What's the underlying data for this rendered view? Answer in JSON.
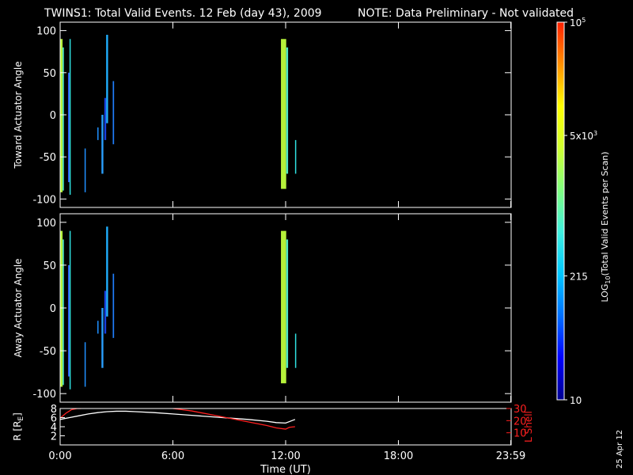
{
  "header": {
    "title": "TWINS1: Total Valid Events. 12 Feb (day  43), 2009",
    "note": "NOTE: Data Preliminary - Not validated",
    "note_color": "#ff2020"
  },
  "footer": {
    "date_stamp": "25 Apr 12"
  },
  "chart_data": [
    {
      "type": "heatmap",
      "name": "toward",
      "ylabel": "Toward Actuator Angle",
      "ylim": [
        -110,
        110
      ],
      "xlim": [
        0,
        24
      ],
      "yticks": [
        -100,
        -50,
        0,
        50,
        100
      ],
      "bars": [
        {
          "x0": 0.0,
          "x1": 0.13,
          "y0": -92,
          "y1": 90,
          "color": "#b6f23a"
        },
        {
          "x0": 0.13,
          "x1": 0.2,
          "y0": -90,
          "y1": 80,
          "color": "#50e8c8"
        },
        {
          "x0": 0.42,
          "x1": 0.5,
          "y0": -80,
          "y1": 50,
          "color": "#3060ff"
        },
        {
          "x0": 0.5,
          "x1": 0.55,
          "y0": -95,
          "y1": 90,
          "color": "#30e0e0"
        },
        {
          "x0": 1.3,
          "x1": 1.36,
          "y0": -92,
          "y1": -40,
          "color": "#2090ff"
        },
        {
          "x0": 1.98,
          "x1": 2.04,
          "y0": -30,
          "y1": -15,
          "color": "#2090ff"
        },
        {
          "x0": 2.2,
          "x1": 2.3,
          "y0": -70,
          "y1": 0,
          "color": "#2aa0ff"
        },
        {
          "x0": 2.35,
          "x1": 2.45,
          "y0": -30,
          "y1": 20,
          "color": "#1840e0"
        },
        {
          "x0": 2.45,
          "x1": 2.55,
          "y0": -10,
          "y1": 95,
          "color": "#20b0ff"
        },
        {
          "x0": 2.8,
          "x1": 2.87,
          "y0": -35,
          "y1": 40,
          "color": "#2080ff"
        },
        {
          "x0": 11.75,
          "x1": 12.03,
          "y0": -88,
          "y1": 90,
          "color": "#b6f23a"
        },
        {
          "x0": 12.03,
          "x1": 12.13,
          "y0": -70,
          "y1": 80,
          "color": "#50e8c8"
        },
        {
          "x0": 12.5,
          "x1": 12.56,
          "y0": -70,
          "y1": -30,
          "color": "#30e0e0"
        }
      ]
    },
    {
      "type": "heatmap",
      "name": "away",
      "ylabel": "Away Actuator Angle",
      "ylim": [
        -110,
        110
      ],
      "xlim": [
        0,
        24
      ],
      "yticks": [
        -100,
        -50,
        0,
        50,
        100
      ],
      "bars": [
        {
          "x0": 0.0,
          "x1": 0.13,
          "y0": -92,
          "y1": 90,
          "color": "#b6f23a"
        },
        {
          "x0": 0.13,
          "x1": 0.2,
          "y0": -90,
          "y1": 80,
          "color": "#50e8c8"
        },
        {
          "x0": 0.42,
          "x1": 0.5,
          "y0": -80,
          "y1": 50,
          "color": "#3060ff"
        },
        {
          "x0": 0.5,
          "x1": 0.55,
          "y0": -95,
          "y1": 90,
          "color": "#30e0e0"
        },
        {
          "x0": 1.3,
          "x1": 1.36,
          "y0": -92,
          "y1": -40,
          "color": "#2090ff"
        },
        {
          "x0": 1.98,
          "x1": 2.04,
          "y0": -30,
          "y1": -15,
          "color": "#2090ff"
        },
        {
          "x0": 2.2,
          "x1": 2.3,
          "y0": -70,
          "y1": 0,
          "color": "#2aa0ff"
        },
        {
          "x0": 2.35,
          "x1": 2.45,
          "y0": -30,
          "y1": 20,
          "color": "#1840e0"
        },
        {
          "x0": 2.45,
          "x1": 2.55,
          "y0": -10,
          "y1": 95,
          "color": "#20b0ff"
        },
        {
          "x0": 2.8,
          "x1": 2.87,
          "y0": -35,
          "y1": 40,
          "color": "#2080ff"
        },
        {
          "x0": 11.75,
          "x1": 12.03,
          "y0": -88,
          "y1": 90,
          "color": "#b6f23a"
        },
        {
          "x0": 12.03,
          "x1": 12.13,
          "y0": -70,
          "y1": 80,
          "color": "#50e8c8"
        },
        {
          "x0": 12.5,
          "x1": 12.56,
          "y0": -70,
          "y1": -30,
          "color": "#30e0e0"
        }
      ]
    },
    {
      "type": "line",
      "name": "ephemeris",
      "ylabel": "R [R",
      "ylabel_sub": "E",
      "ylabel_close": "]",
      "ylim": [
        0,
        8
      ],
      "yticks": [
        2,
        4,
        6,
        8
      ],
      "ylabel_right": "L Shell",
      "ylim_right": [
        0,
        30
      ],
      "yticks_right": [
        10,
        20,
        30
      ],
      "right_color": "#ff2020",
      "xlim": [
        0,
        24
      ],
      "xticks": [
        0,
        6,
        12,
        18,
        23.98
      ],
      "xticklabels": [
        "0:00",
        "6:00",
        "12:00",
        "18:00",
        "23:59"
      ],
      "xlabel": "Time (UT)",
      "series": [
        {
          "axis": "left",
          "color": "#ffffff",
          "x": [
            0,
            0.5,
            1,
            1.5,
            2,
            2.5,
            3,
            3.5,
            4,
            5,
            6,
            7,
            8,
            9,
            10,
            11,
            11.5,
            12,
            12.5
          ],
          "y": [
            5.6,
            6.0,
            6.4,
            6.8,
            7.1,
            7.3,
            7.4,
            7.4,
            7.3,
            7.1,
            6.8,
            6.5,
            6.2,
            5.9,
            5.6,
            5.2,
            4.9,
            4.8,
            5.6
          ]
        },
        {
          "axis": "right",
          "color": "#ff2020",
          "x": [
            0,
            0.3,
            0.6,
            0.9,
            1.1
          ],
          "y": [
            22,
            26,
            29,
            30,
            30
          ]
        },
        {
          "axis": "right",
          "color": "#ff2020",
          "x": [
            6.0,
            6.5,
            7,
            8,
            9,
            10,
            11,
            11.5,
            12,
            12.2,
            12.5
          ],
          "y": [
            30,
            29,
            28,
            25,
            22,
            19,
            16,
            14,
            13,
            14.5,
            15
          ]
        }
      ]
    }
  ],
  "colorbar": {
    "label": "LOG",
    "label_sub": "10",
    "label_rest": "(Total Valid  Events per Scan)",
    "ticks": [
      {
        "frac": 0.0,
        "text": "10",
        "sup": ""
      },
      {
        "frac": 0.328,
        "text": "215",
        "sup": ""
      },
      {
        "frac": 0.7,
        "text": "5x10",
        "sup": "3"
      },
      {
        "frac": 1.0,
        "text": "10",
        "sup": "5"
      }
    ],
    "stops": [
      "#000090",
      "#0000ff",
      "#0070ff",
      "#00c8ff",
      "#40f0e0",
      "#80ff80",
      "#d0ff30",
      "#ffff00",
      "#ff9000",
      "#ff2000"
    ]
  }
}
